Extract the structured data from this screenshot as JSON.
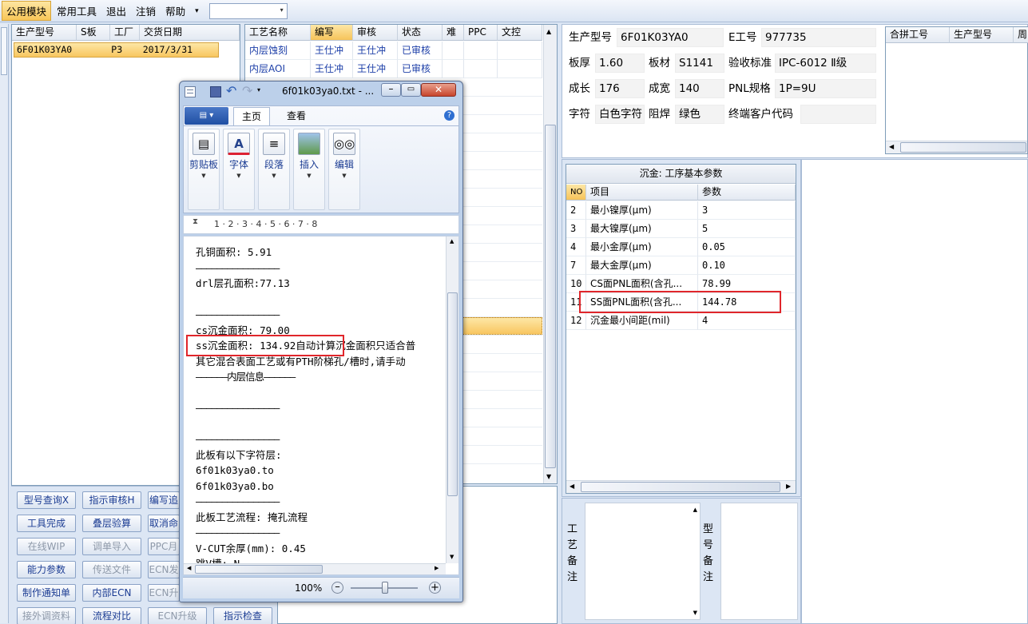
{
  "menubar": {
    "items": [
      "公用模块",
      "常用工具",
      "退出",
      "注销",
      "帮助"
    ],
    "dropdown_arrow": "▾"
  },
  "left_grid": {
    "columns": [
      "生产型号",
      "S板",
      "工厂",
      "交货日期"
    ],
    "row": [
      "6F01K03YA0",
      "",
      "P3",
      "2017/3/31"
    ]
  },
  "process_grid": {
    "columns": [
      "工艺名称",
      "编写",
      "审核",
      "状态",
      "难",
      "PPC",
      "文控"
    ],
    "rows": [
      [
        "内层蚀刻",
        "王仕冲",
        "王仕冲",
        "已审核"
      ],
      [
        "内层AOI",
        "王仕冲",
        "王仕冲",
        "已审核"
      ]
    ]
  },
  "buttons": [
    [
      "型号查询X",
      "指示审核H",
      "编写追"
    ],
    [
      "工具完成",
      "叠层验算",
      "取消命"
    ],
    [
      "在线WIP",
      "调单导入",
      "PPC月"
    ],
    [
      "能力参数",
      "传送文件",
      "ECN发"
    ],
    [
      "制作通知单",
      "内部ECN",
      "ECN升"
    ],
    [
      "接外调资料",
      "流程对比",
      "ECN升级",
      "指示检查"
    ]
  ],
  "info": {
    "prod_label": "生产型号",
    "prod": "6F01K03YA0",
    "e_label": "E工号",
    "e": "977735",
    "thick_label": "板厚",
    "thick": "1.60",
    "material_label": "板材",
    "material": "S1141",
    "std_label": "验收标准",
    "std": "IPC-6012 Ⅱ级",
    "len_label": "成长",
    "len": "176",
    "wid_label": "成宽",
    "wid": "140",
    "pnl_label": "PNL规格",
    "pnl": "1P=9U",
    "char_label": "字符",
    "char": "白色字符",
    "mask_label": "阻焊",
    "mask": "绿色",
    "cust_label": "终端客户代码",
    "cust": ""
  },
  "combine_grid": {
    "columns": [
      "合拼工号",
      "生产型号",
      "周"
    ]
  },
  "param_panel": {
    "title": "沉金: 工序基本参数",
    "columns": [
      "NO",
      "项目",
      "参数"
    ],
    "rows": [
      [
        "2",
        "最小镍厚(μm)",
        "3"
      ],
      [
        "3",
        "最大镍厚(μm)",
        "5"
      ],
      [
        "4",
        "最小金厚(μm)",
        "0.05"
      ],
      [
        "7",
        "最大金厚(μm)",
        "0.10"
      ],
      [
        "10",
        "CS面PNL面积(含孔...",
        "78.99"
      ],
      [
        "11",
        "SS面PNL面积(含孔...",
        "144.78"
      ],
      [
        "12",
        "沉金最小间距(mil)",
        "4"
      ]
    ]
  },
  "remarks": {
    "process": "工艺备注",
    "model": "型号备注"
  },
  "notepad": {
    "title": "6f01k03ya0.txt - ...",
    "tabs": [
      "主页",
      "查看"
    ],
    "ribbon": [
      "剪贴板",
      "字体",
      "段落",
      "插入",
      "编辑"
    ],
    "ruler": "1 · 2 · 3 · 4 · 5 · 6 · 7 · 8",
    "lines": [
      "孔铜面积: 5.91",
      "————————————————",
      "drl层孔面积:77.13",
      "",
      "————————————————",
      "cs沉金面积: 79.00",
      "ss沉金面积: 134.92自动计算沉金面积只适合普",
      "其它混合表面工艺或有PTH阶梯孔/槽时,请手动",
      "——————内层信息——————",
      "",
      "————————————————",
      "",
      "————————————————",
      "此板有以下字符层:",
      "6f01k03ya0.to",
      "6f01k03ya0.bo",
      "————————————————",
      "此板工艺流程: 掩孔流程",
      "————————————————",
      "V-CUT余厚(mm): 0.45",
      "跳V槽: N"
    ],
    "zoom": "100%"
  },
  "colors": {
    "accent": "#f8c658",
    "highlight_box": "#e0262b",
    "link": "#1d3fa8"
  }
}
